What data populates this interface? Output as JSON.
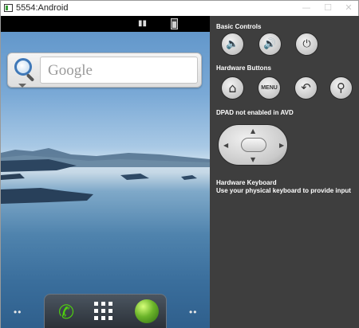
{
  "window": {
    "title": "5554:Android",
    "min_glyph": "—",
    "max_glyph": "☐",
    "close_glyph": "✕"
  },
  "statusbar": {
    "time": "",
    "signal_glyph": "▮▮"
  },
  "search": {
    "placeholder": "Google"
  },
  "dock": {
    "phone_icon": "phone-icon",
    "apps_icon": "app-drawer-icon",
    "browser_icon": "browser-icon",
    "left_dots": "••",
    "right_dots": "••"
  },
  "panel": {
    "basic_controls_title": "Basic Controls",
    "hardware_buttons_title": "Hardware Buttons",
    "dpad_title": "DPAD not enabled in AVD",
    "keyboard_title": "Hardware Keyboard",
    "keyboard_hint": "Use your physical keyboard to provide input",
    "basic": [
      {
        "name": "volume-down",
        "glyph": "🔈"
      },
      {
        "name": "volume-up",
        "glyph": "🔊"
      },
      {
        "name": "power",
        "glyph": "⏻"
      }
    ],
    "hardware": [
      {
        "name": "home",
        "glyph": "⌂"
      },
      {
        "name": "menu",
        "glyph": "MENU"
      },
      {
        "name": "back",
        "glyph": "↶"
      },
      {
        "name": "search",
        "glyph": "⚲"
      }
    ],
    "dpad_arrows": {
      "up": "▲",
      "down": "▼",
      "left": "◀",
      "right": "▶"
    }
  },
  "colors": {
    "panel_bg": "#3e3e3e",
    "dock_phone": "#4fd10e",
    "status_bar": "#000000"
  }
}
